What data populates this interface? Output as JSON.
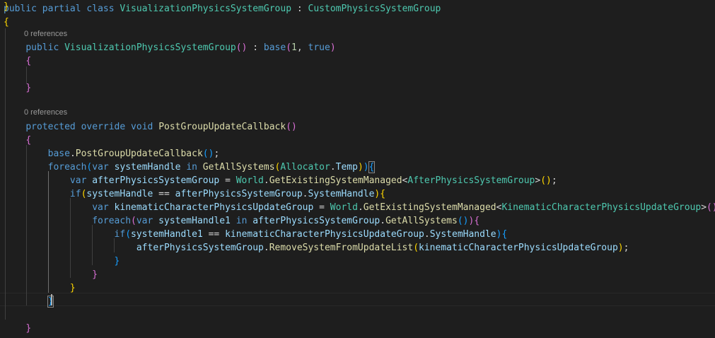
{
  "codelens": {
    "constructor_refs": "0 references",
    "method_refs": "0 references"
  },
  "lines": [
    [
      [
        "k",
        "public"
      ],
      [
        "p",
        " "
      ],
      [
        "k",
        "partial"
      ],
      [
        "p",
        " "
      ],
      [
        "k",
        "class"
      ],
      [
        "p",
        " "
      ],
      [
        "t",
        "VisualizationPhysicsSystemGroup"
      ],
      [
        "p",
        " : "
      ],
      [
        "t",
        "CustomPhysicsSystemGroup"
      ]
    ],
    [
      [
        "b1",
        "{"
      ]
    ],
    [
      [
        "p",
        "    "
      ],
      [
        "k",
        "public"
      ],
      [
        "p",
        " "
      ],
      [
        "t",
        "VisualizationPhysicsSystemGroup"
      ],
      [
        "b2",
        "()"
      ],
      [
        "p",
        " : "
      ],
      [
        "k",
        "base"
      ],
      [
        "b2",
        "("
      ],
      [
        "n",
        "1"
      ],
      [
        "p",
        ", "
      ],
      [
        "k",
        "true"
      ],
      [
        "b2",
        ")"
      ]
    ],
    [
      [
        "p",
        "    "
      ],
      [
        "b2",
        "{"
      ]
    ],
    [],
    [
      [
        "p",
        "    "
      ],
      [
        "b2",
        "}"
      ]
    ],
    [],
    [
      [
        "p",
        "    "
      ],
      [
        "k",
        "protected"
      ],
      [
        "p",
        " "
      ],
      [
        "k",
        "override"
      ],
      [
        "p",
        " "
      ],
      [
        "k",
        "void"
      ],
      [
        "p",
        " "
      ],
      [
        "f",
        "PostGroupUpdateCallback"
      ],
      [
        "b2",
        "()"
      ]
    ],
    [
      [
        "p",
        "    "
      ],
      [
        "b2",
        "{"
      ]
    ],
    [
      [
        "p",
        "        "
      ],
      [
        "k",
        "base"
      ],
      [
        "p",
        "."
      ],
      [
        "f",
        "PostGroupUpdateCallback"
      ],
      [
        "b3",
        "()"
      ],
      [
        "p",
        ";"
      ]
    ],
    [
      [
        "p",
        "        "
      ],
      [
        "k",
        "foreach"
      ],
      [
        "b3",
        "("
      ],
      [
        "k",
        "var"
      ],
      [
        "p",
        " "
      ],
      [
        "v",
        "systemHandle"
      ],
      [
        "p",
        " "
      ],
      [
        "k",
        "in"
      ],
      [
        "p",
        " "
      ],
      [
        "f",
        "GetAllSystems"
      ],
      [
        "b1",
        "("
      ],
      [
        "t",
        "Allocator"
      ],
      [
        "p",
        "."
      ],
      [
        "v",
        "Temp"
      ],
      [
        "b1",
        ")"
      ],
      [
        "b3",
        ")"
      ],
      [
        "b3bm",
        "{"
      ]
    ],
    [
      [
        "p",
        "            "
      ],
      [
        "k",
        "var"
      ],
      [
        "p",
        " "
      ],
      [
        "v",
        "afterPhysicsSystemGroup"
      ],
      [
        "p",
        " = "
      ],
      [
        "t",
        "World"
      ],
      [
        "p",
        "."
      ],
      [
        "f",
        "GetExistingSystemManaged"
      ],
      [
        "p",
        "<"
      ],
      [
        "t",
        "AfterPhysicsSystemGroup"
      ],
      [
        "p",
        ">"
      ],
      [
        "b1",
        "()"
      ],
      [
        "p",
        ";"
      ]
    ],
    [
      [
        "p",
        "            "
      ],
      [
        "k",
        "if"
      ],
      [
        "b1",
        "("
      ],
      [
        "v",
        "systemHandle"
      ],
      [
        "p",
        " == "
      ],
      [
        "v",
        "afterPhysicsSystemGroup"
      ],
      [
        "p",
        "."
      ],
      [
        "v",
        "SystemHandle"
      ],
      [
        "b1",
        ")"
      ],
      [
        "b1",
        "{"
      ]
    ],
    [
      [
        "p",
        "                "
      ],
      [
        "k",
        "var"
      ],
      [
        "p",
        " "
      ],
      [
        "v",
        "kinematicCharacterPhysicsUpdateGroup"
      ],
      [
        "p",
        " = "
      ],
      [
        "t",
        "World"
      ],
      [
        "p",
        "."
      ],
      [
        "f",
        "GetExistingSystemManaged"
      ],
      [
        "p",
        "<"
      ],
      [
        "t",
        "KinematicCharacterPhysicsUpdateGroup"
      ],
      [
        "p",
        ">"
      ],
      [
        "b2",
        "()"
      ],
      [
        "p",
        ";"
      ]
    ],
    [
      [
        "p",
        "                "
      ],
      [
        "k",
        "foreach"
      ],
      [
        "b2",
        "("
      ],
      [
        "k",
        "var"
      ],
      [
        "p",
        " "
      ],
      [
        "v",
        "systemHandle1"
      ],
      [
        "p",
        " "
      ],
      [
        "k",
        "in"
      ],
      [
        "p",
        " "
      ],
      [
        "v",
        "afterPhysicsSystemGroup"
      ],
      [
        "p",
        "."
      ],
      [
        "f",
        "GetAllSystems"
      ],
      [
        "b3",
        "()"
      ],
      [
        "b2",
        ")"
      ],
      [
        "b2",
        "{"
      ]
    ],
    [
      [
        "p",
        "                    "
      ],
      [
        "k",
        "if"
      ],
      [
        "b3",
        "("
      ],
      [
        "v",
        "systemHandle1"
      ],
      [
        "p",
        " == "
      ],
      [
        "v",
        "kinematicCharacterPhysicsUpdateGroup"
      ],
      [
        "p",
        "."
      ],
      [
        "v",
        "SystemHandle"
      ],
      [
        "b3",
        ")"
      ],
      [
        "b3",
        "{"
      ]
    ],
    [
      [
        "p",
        "                        "
      ],
      [
        "v",
        "afterPhysicsSystemGroup"
      ],
      [
        "p",
        "."
      ],
      [
        "f",
        "RemoveSystemFromUpdateList"
      ],
      [
        "b1",
        "("
      ],
      [
        "v",
        "kinematicCharacterPhysicsUpdateGroup"
      ],
      [
        "b1",
        ")"
      ],
      [
        "p",
        ";"
      ]
    ],
    [
      [
        "p",
        "                    "
      ],
      [
        "b3",
        "}"
      ]
    ],
    [
      [
        "p",
        "                "
      ],
      [
        "b2",
        "}"
      ]
    ],
    [
      [
        "p",
        "            "
      ],
      [
        "b1",
        "}"
      ]
    ],
    [
      [
        "p",
        "        "
      ],
      [
        "b3bm",
        "}"
      ]
    ],
    [],
    [
      [
        "p",
        "    "
      ],
      [
        "b2",
        "}"
      ]
    ],
    [
      [
        "b1",
        "}"
      ]
    ]
  ]
}
